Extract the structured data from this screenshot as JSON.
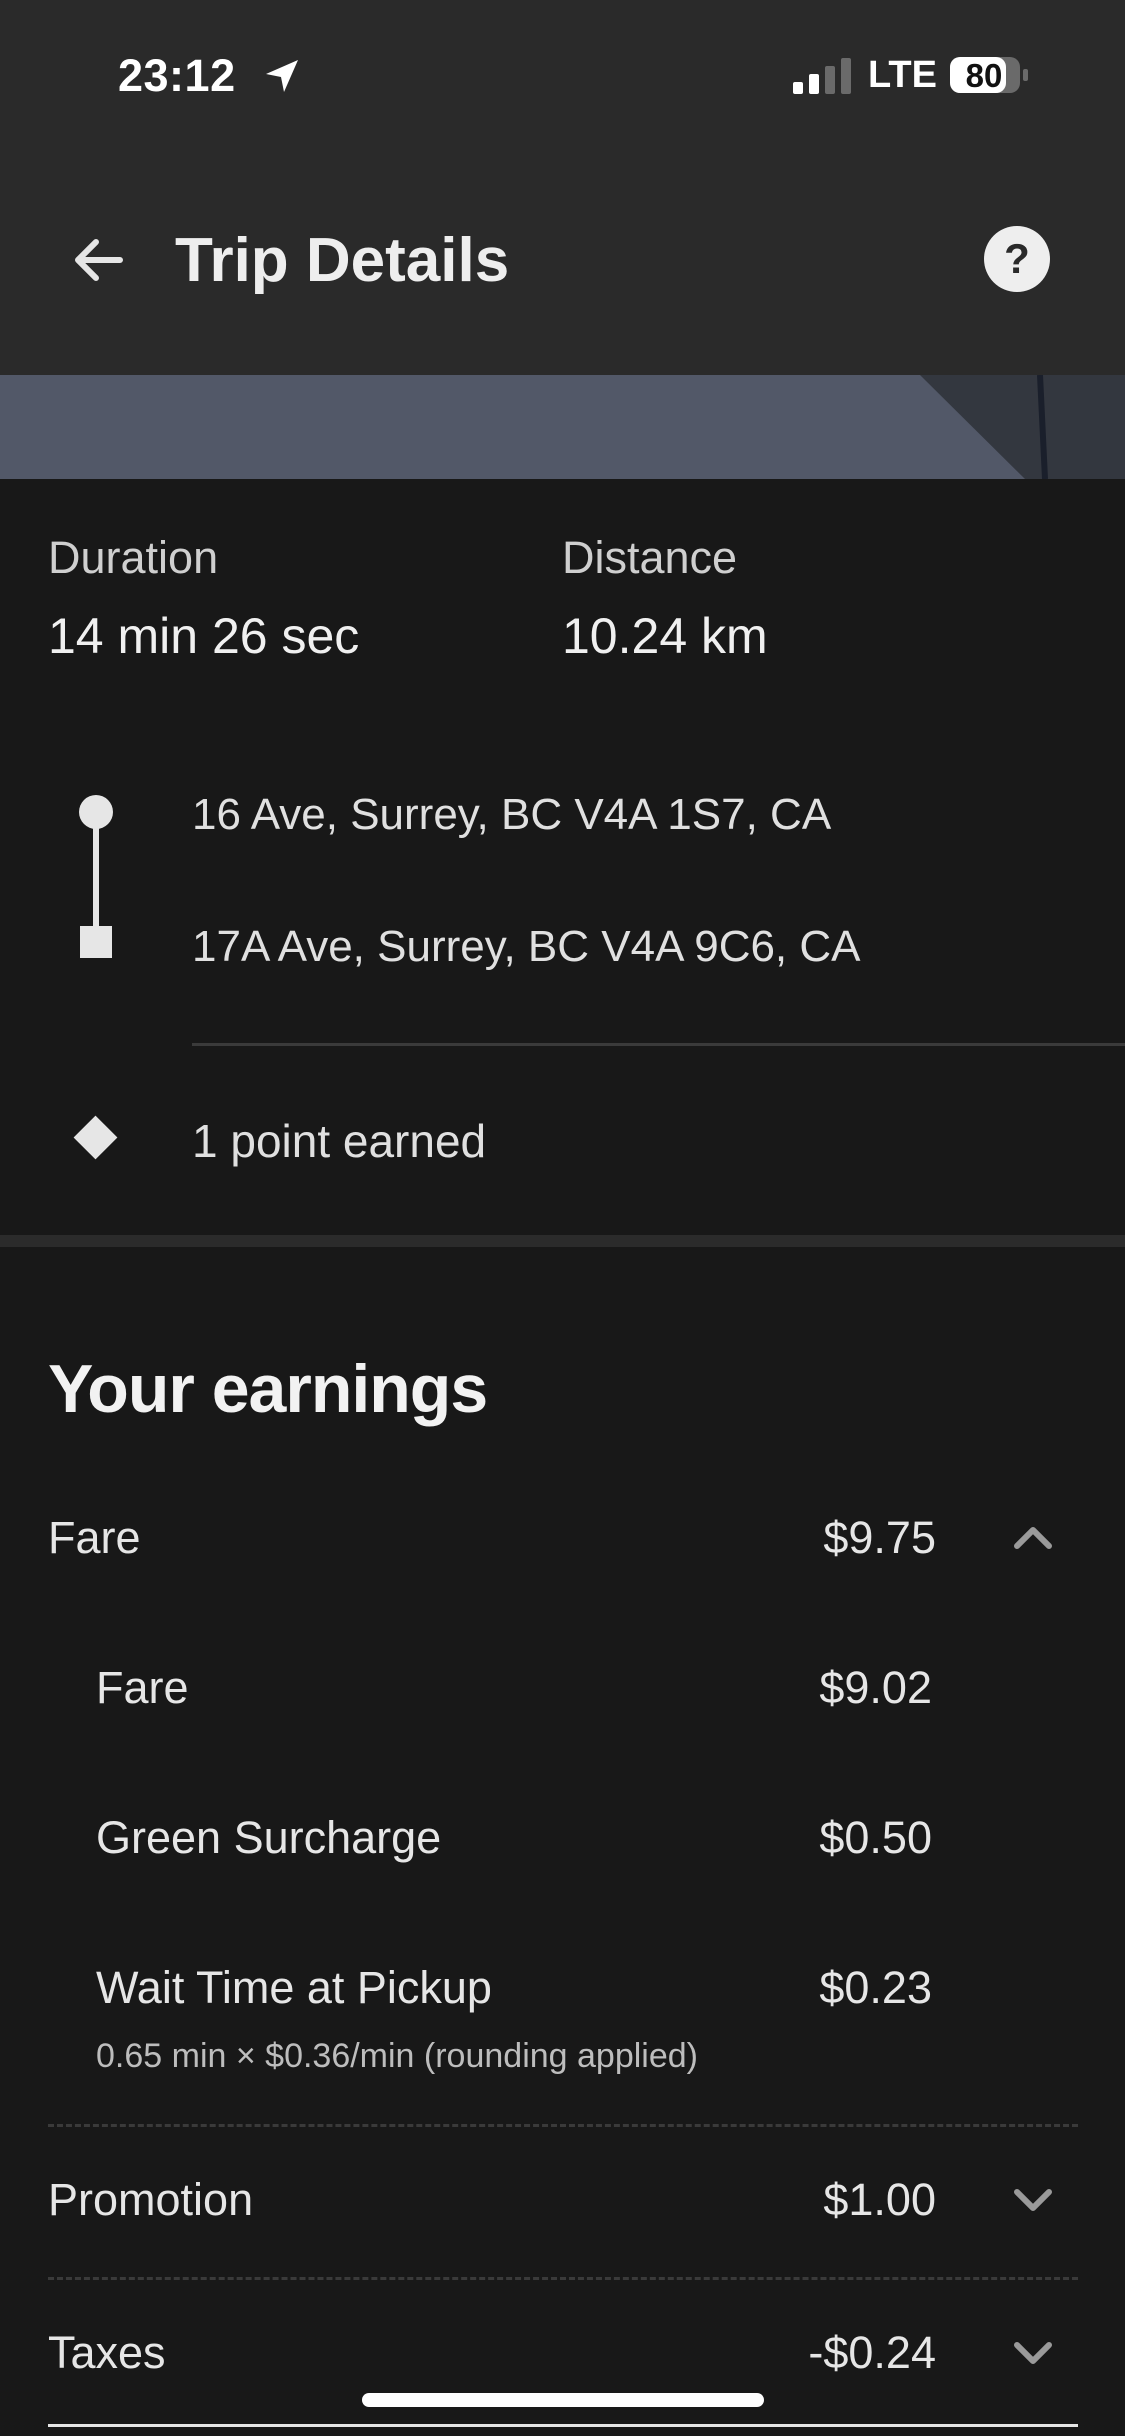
{
  "status_bar": {
    "time": "23:12",
    "network": "LTE",
    "battery": "80"
  },
  "header": {
    "title": "Trip Details"
  },
  "trip": {
    "duration_label": "Duration",
    "duration_value": "14 min 26 sec",
    "distance_label": "Distance",
    "distance_value": "10.24 km",
    "pickup_address": "16 Ave, Surrey, BC V4A 1S7, CA",
    "dropoff_address": "17A Ave, Surrey, BC V4A 9C6, CA",
    "points": "1 point earned"
  },
  "earnings": {
    "title": "Your earnings",
    "fare": {
      "label": "Fare",
      "amount": "$9.75",
      "expanded": true,
      "items": [
        {
          "label": "Fare",
          "amount": "$9.02"
        },
        {
          "label": "Green Surcharge",
          "amount": "$0.50"
        },
        {
          "label": "Wait Time at Pickup",
          "amount": "$0.23",
          "note": "0.65 min × $0.36/min (rounding applied)"
        }
      ]
    },
    "promotion": {
      "label": "Promotion",
      "amount": "$1.00"
    },
    "taxes": {
      "label": "Taxes",
      "amount": "-$0.24"
    }
  },
  "icons": {
    "back": "arrow-left-icon",
    "help": "help-icon",
    "location": "location-arrow-icon",
    "route_start": "circle-icon",
    "route_end": "square-icon",
    "points": "diamond-icon",
    "expand": "chevron-down-icon",
    "collapse": "chevron-up-icon"
  },
  "colors": {
    "background": "#181818",
    "header": "#2a2a2a",
    "map": "#525868",
    "text": "#e6e6e6"
  }
}
